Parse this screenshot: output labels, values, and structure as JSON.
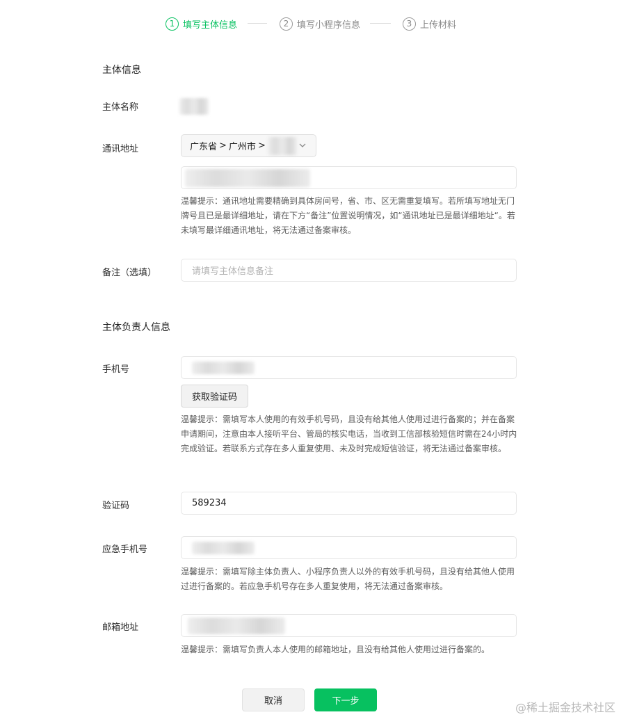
{
  "stepper": {
    "steps": [
      {
        "num": "1",
        "label": "填写主体信息",
        "state": "active"
      },
      {
        "num": "2",
        "label": "填写小程序信息",
        "state": "pending"
      },
      {
        "num": "3",
        "label": "上传材料",
        "state": "pending"
      }
    ]
  },
  "subject_section": {
    "title": "主体信息",
    "name_label": "主体名称",
    "address_label": "通讯地址",
    "region_select": {
      "province": "广东省",
      "city": "广州市",
      "sep": ">"
    },
    "address_hint": "温馨提示：通讯地址需要精确到具体房间号，省、市、区无需重复填写。若所填写地址无门牌号且已是最详细地址，请在下方“备注”位置说明情况，如“通讯地址已是最详细地址“。若未填写最详细通讯地址，将无法通过备案审核。",
    "remark_label": "备注（选填）",
    "remark_placeholder": "请填写主体信息备注"
  },
  "owner_section": {
    "title": "主体负责人信息",
    "phone_label": "手机号",
    "get_code_button": "获取验证码",
    "phone_hint": "温馨提示：需填写本人使用的有效手机号码，且没有给其他人使用过进行备案的；并在备案申请期间，注意由本人接听平台、管局的核实电话，当收到工信部核验短信时需在24小时内完成验证。若联系方式存在多人重复使用、未及时完成短信验证，将无法通过备案审核。",
    "code_label": "验证码",
    "code_value": "589234",
    "emergency_label": "应急手机号",
    "emergency_hint": "温馨提示：需填写除主体负责人、小程序负责人以外的有效手机号码，且没有给其他人使用过进行备案的。若应急手机号存在多人重复使用，将无法通过备案审核。",
    "email_label": "邮箱地址",
    "email_hint": "温馨提示：需填写负责人本人使用的邮箱地址，且没有给其他人使用过进行备案的。"
  },
  "footer": {
    "cancel_button": "取消",
    "next_button": "下一步"
  },
  "watermark": "@稀土掘金技术社区",
  "colors": {
    "accent": "#07c160",
    "hint_text": "#5c5c5c",
    "border": "#e5e5e5"
  }
}
